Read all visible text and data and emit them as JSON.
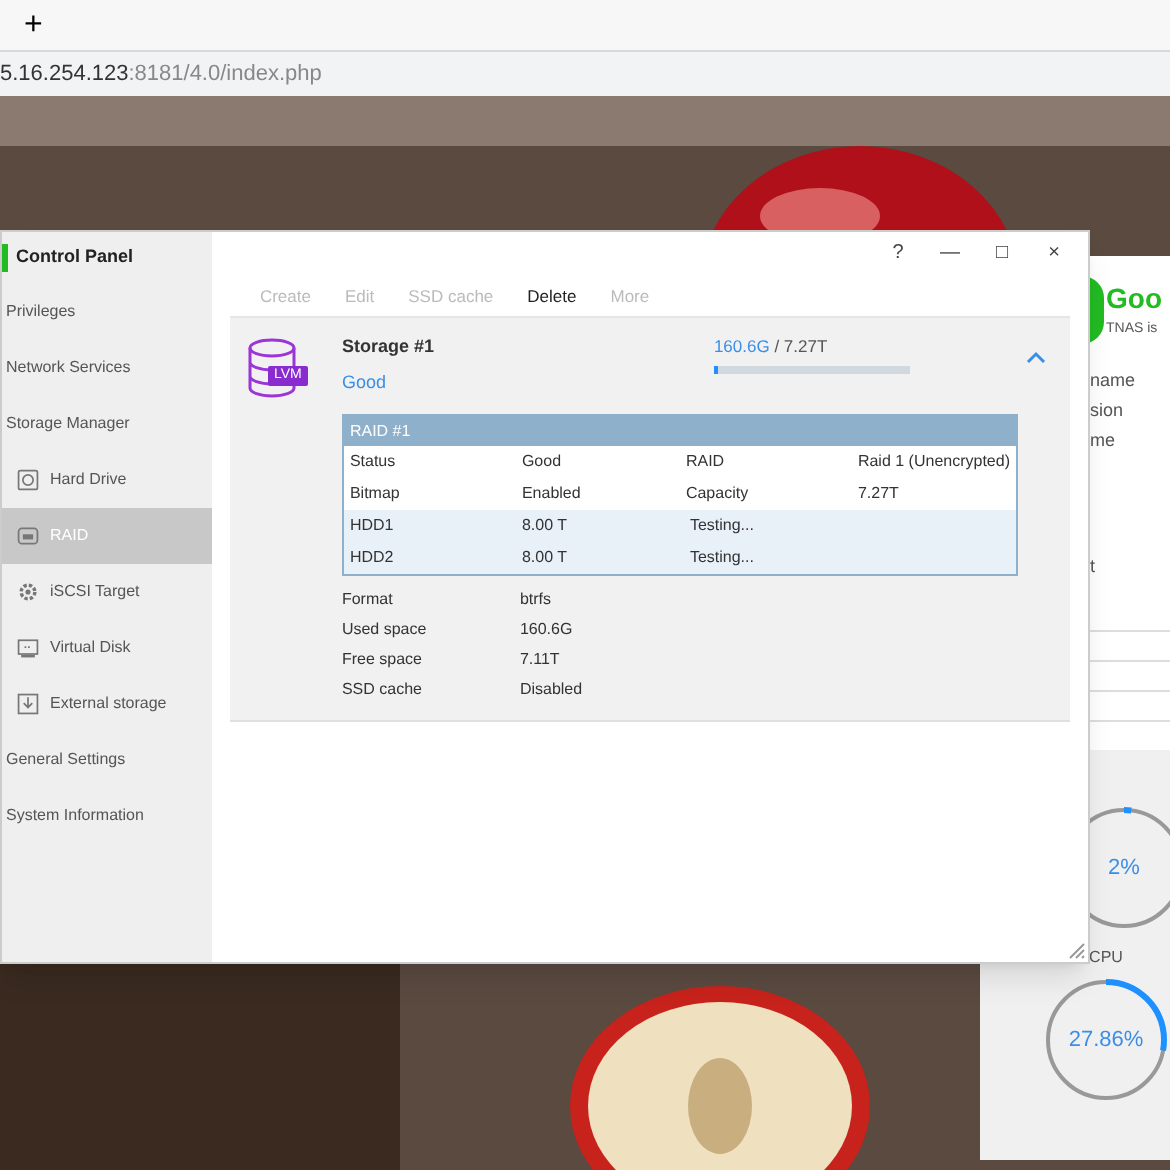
{
  "browser": {
    "new_tab": "+",
    "address_host": "5.16.254.123",
    "address_rest": ":8181/4.0/index.php"
  },
  "window": {
    "title": "Control Panel",
    "controls": [
      "?",
      "—",
      "□",
      "×"
    ]
  },
  "sidebar": {
    "items": [
      {
        "label": "Privileges",
        "kind": "section",
        "selected": false
      },
      {
        "label": "Network Services",
        "kind": "section",
        "selected": false
      },
      {
        "label": "Storage Manager",
        "kind": "section",
        "selected": false
      },
      {
        "label": "Hard Drive",
        "kind": "sub",
        "selected": false
      },
      {
        "label": "RAID",
        "kind": "sub",
        "selected": true
      },
      {
        "label": "iSCSI Target",
        "kind": "sub",
        "selected": false
      },
      {
        "label": "Virtual Disk",
        "kind": "sub",
        "selected": false
      },
      {
        "label": "External storage",
        "kind": "sub",
        "selected": false
      },
      {
        "label": "General Settings",
        "kind": "section",
        "selected": false
      },
      {
        "label": "System Information",
        "kind": "section",
        "selected": false
      }
    ]
  },
  "toolbar": [
    {
      "label": "Create",
      "disabled": true
    },
    {
      "label": "Edit",
      "disabled": true
    },
    {
      "label": "SSD cache",
      "disabled": true
    },
    {
      "label": "Delete",
      "disabled": false
    },
    {
      "label": "More",
      "disabled": true
    }
  ],
  "storage": {
    "badge": "LVM",
    "name": "Storage #1",
    "status": "Good",
    "used": "160.6G",
    "total": " / 7.27T",
    "level": 0.02,
    "expanded": true,
    "raid": {
      "title": "RAID #1",
      "rows": [
        {
          "kind": "info",
          "cells": [
            "Status",
            "Good",
            "RAID",
            "Raid 1 (Unencrypted)"
          ]
        },
        {
          "kind": "info",
          "cells": [
            "Bitmap",
            "Enabled",
            "Capacity",
            "7.27T"
          ]
        },
        {
          "kind": "disk",
          "cells": [
            "HDD1",
            "8.00 T",
            "Testing..."
          ]
        },
        {
          "kind": "disk",
          "cells": [
            "HDD2",
            "8.00 T",
            "Testing..."
          ]
        }
      ]
    },
    "details": [
      [
        "Format",
        "btrfs"
      ],
      [
        "Used space",
        "160.6G"
      ],
      [
        "Free space",
        "7.11T"
      ],
      [
        "SSD cache",
        "Disabled"
      ]
    ]
  },
  "background_panel": {
    "status": "Goo",
    "subtitle": "TNAS is",
    "labels": [
      "name",
      "sion",
      "me",
      "t"
    ],
    "meters": [
      {
        "reading": "2%",
        "level": 0.02
      },
      {
        "label": "CPU",
        "reading": "27.86%",
        "level": 0.2786
      }
    ]
  }
}
